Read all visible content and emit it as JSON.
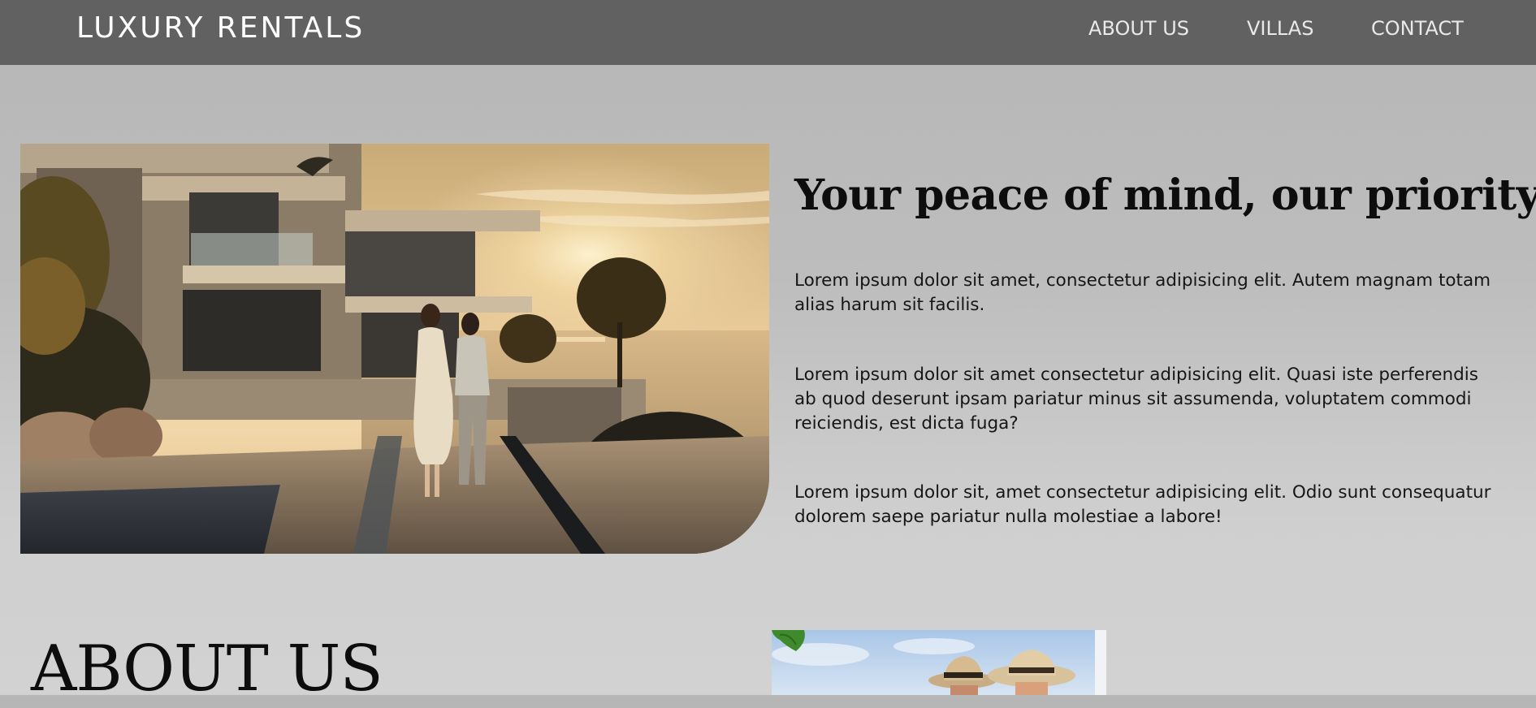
{
  "navbar": {
    "brand": "LUXURY RENTALS",
    "links": [
      {
        "label": "ABOUT US"
      },
      {
        "label": "VILLAS"
      },
      {
        "label": "CONTACT"
      }
    ]
  },
  "hero": {
    "title": "Your peace of mind, our priority!",
    "paragraphs": [
      {
        "lines": [
          "Lorem ipsum dolor sit amet, consectetur adipisicing elit. Autem magnam totam",
          "alias harum sit facilis."
        ]
      },
      {
        "lines": [
          "Lorem ipsum dolor sit amet consectetur adipisicing elit. Quasi iste perferendis",
          "ab quod deserunt ipsam pariatur minus sit assumenda, voluptatem commodi",
          "reiciendis, est dicta fuga?"
        ]
      },
      {
        "lines": [
          "Lorem ipsum dolor sit, amet consectetur adipisicing elit. Odio sunt consequatur",
          "dolorem saepe pariatur nulla molestiae a labore!"
        ]
      }
    ]
  },
  "about": {
    "heading": "ABOUT US"
  },
  "colors": {
    "navbar_bg": "#616161",
    "page_bg": "#b6b6b6",
    "heading_text": "#0d0d0d",
    "nav_text": "#e9e9e9"
  }
}
